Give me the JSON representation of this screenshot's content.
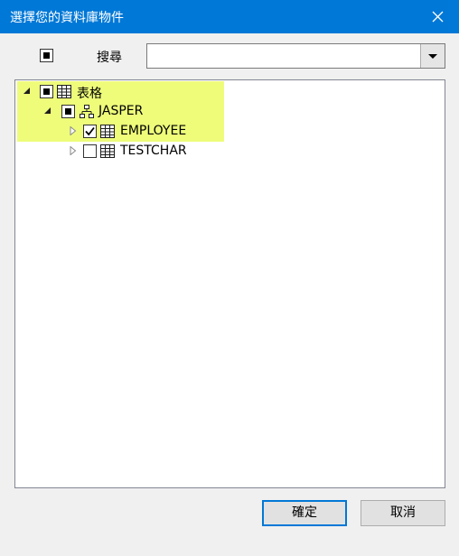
{
  "window": {
    "title": "選擇您的資料庫物件",
    "close_icon": "close-icon"
  },
  "search": {
    "label": "搜尋",
    "value": "",
    "select_all_state": "indeterminate"
  },
  "tree": {
    "root": {
      "label": "表格",
      "icon": "table-icon",
      "expanded": true,
      "check": "indeterminate"
    },
    "schema": {
      "label": "JASPER",
      "icon": "schema-icon",
      "expanded": true,
      "check": "indeterminate"
    },
    "items": [
      {
        "label": "EMPLOYEE",
        "icon": "table-icon",
        "expanded": false,
        "check": "checked"
      },
      {
        "label": "TESTCHAR",
        "icon": "table-icon",
        "expanded": false,
        "check": "unchecked"
      }
    ],
    "highlight_color": "#eefc7a"
  },
  "buttons": {
    "ok": "確定",
    "cancel": "取消"
  },
  "colors": {
    "titlebar": "#0078d7",
    "accent": "#0078d7"
  }
}
